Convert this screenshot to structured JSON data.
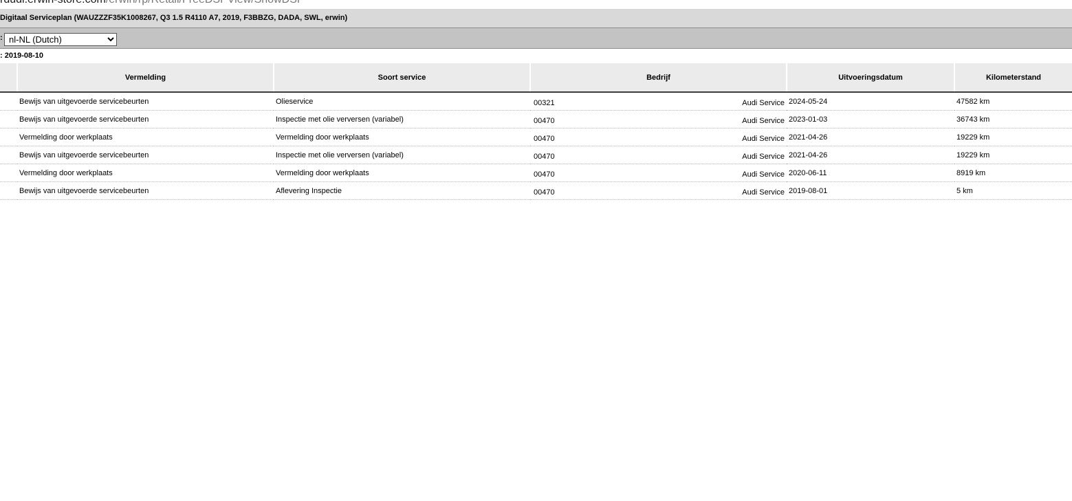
{
  "url": {
    "host": "rdudi.erwin-store.com",
    "path": "/erwin/rp/Retail/FreeDSPView/ShowDSP"
  },
  "header": {
    "title": "Digitaal Serviceplan (WAUZZZF35K1008267, Q3 1.5 R4110 A7, 2019, F3BBZG, DADA, SWL, erwin)"
  },
  "language": {
    "label_suffix": ":",
    "selected": "nl-NL (Dutch)"
  },
  "date_line": ": 2019-08-10",
  "table": {
    "columns": [
      "",
      "Vermelding",
      "Soort service",
      "Bedrijf",
      "Uitvoeringsdatum",
      "Kilometerstand"
    ],
    "rows": [
      {
        "vermelding": "Bewijs van uitgevoerde servicebeurten",
        "soort": "Olieservice",
        "code": "00321",
        "bedrijf": "Audi Service",
        "datum": "2024-05-24",
        "km": "47582 km"
      },
      {
        "vermelding": "Bewijs van uitgevoerde servicebeurten",
        "soort": "Inspectie met olie verversen (variabel)",
        "code": "00470",
        "bedrijf": "Audi Service",
        "datum": "2023-01-03",
        "km": "36743 km"
      },
      {
        "vermelding": "Vermelding door werkplaats",
        "soort": "Vermelding door werkplaats",
        "code": "00470",
        "bedrijf": "Audi Service",
        "datum": "2021-04-26",
        "km": "19229 km"
      },
      {
        "vermelding": "Bewijs van uitgevoerde servicebeurten",
        "soort": "Inspectie met olie verversen (variabel)",
        "code": "00470",
        "bedrijf": "Audi Service",
        "datum": "2021-04-26",
        "km": "19229 km"
      },
      {
        "vermelding": "Vermelding door werkplaats",
        "soort": "Vermelding door werkplaats",
        "code": "00470",
        "bedrijf": "Audi Service",
        "datum": "2020-06-11",
        "km": "8919 km"
      },
      {
        "vermelding": "Bewijs van uitgevoerde servicebeurten",
        "soort": "Aflevering Inspectie",
        "code": "00470",
        "bedrijf": "Audi Service",
        "datum": "2019-08-01",
        "km": "5 km"
      }
    ]
  }
}
